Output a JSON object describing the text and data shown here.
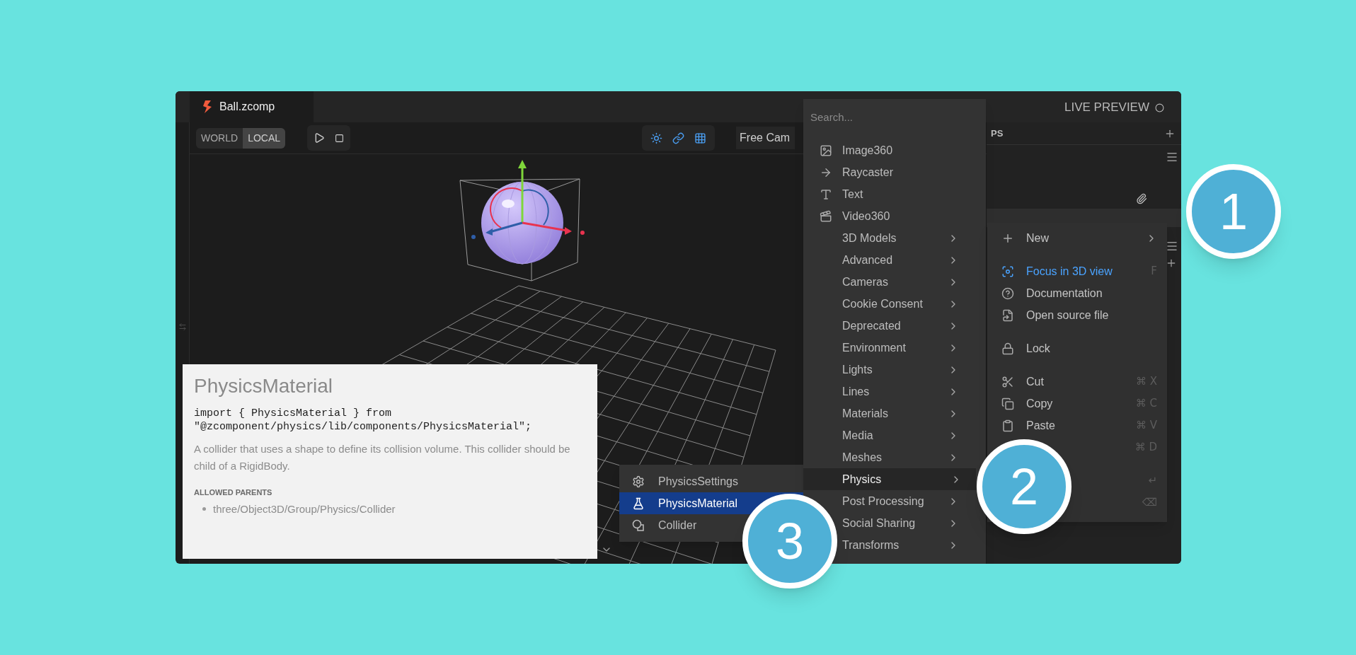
{
  "tab": {
    "title": "Ball.zcomp"
  },
  "live_preview": {
    "label": "LIVE PREVIEW"
  },
  "space_toggle": [
    {
      "label": "WORLD",
      "selected": false
    },
    {
      "label": "LOCAL",
      "selected": true
    }
  ],
  "camera_field": {
    "value": "Free Cam"
  },
  "panel": {
    "header": "PS"
  },
  "add_menu": {
    "search": {
      "placeholder": "Search..."
    },
    "items": [
      {
        "label": "Image360",
        "kind": "component",
        "selected": false
      },
      {
        "label": "Raycaster",
        "kind": "component",
        "selected": false
      },
      {
        "label": "Text",
        "kind": "component",
        "selected": false
      },
      {
        "label": "Video360",
        "kind": "component",
        "selected": false
      },
      {
        "label": "3D Models",
        "kind": "category",
        "selected": false
      },
      {
        "label": "Advanced",
        "kind": "category",
        "selected": false
      },
      {
        "label": "Cameras",
        "kind": "category",
        "selected": false
      },
      {
        "label": "Cookie Consent",
        "kind": "category",
        "selected": false
      },
      {
        "label": "Deprecated",
        "kind": "category",
        "selected": false
      },
      {
        "label": "Environment",
        "kind": "category",
        "selected": false
      },
      {
        "label": "Lights",
        "kind": "category",
        "selected": false
      },
      {
        "label": "Lines",
        "kind": "category",
        "selected": false
      },
      {
        "label": "Materials",
        "kind": "category",
        "selected": false
      },
      {
        "label": "Media",
        "kind": "category",
        "selected": false
      },
      {
        "label": "Meshes",
        "kind": "category",
        "selected": false
      },
      {
        "label": "Physics",
        "kind": "category",
        "selected": true
      },
      {
        "label": "Post Processing",
        "kind": "category",
        "selected": false
      },
      {
        "label": "Social Sharing",
        "kind": "category",
        "selected": false
      },
      {
        "label": "Transforms",
        "kind": "category",
        "selected": false
      }
    ]
  },
  "physics_menu": {
    "items": [
      {
        "label": "PhysicsSettings",
        "selected": false
      },
      {
        "label": "PhysicsMaterial",
        "selected": true
      },
      {
        "label": "Collider",
        "selected": false
      }
    ]
  },
  "context_menu": {
    "groups": [
      {
        "items": [
          {
            "label": "New",
            "kind": "submenu",
            "selected": false
          }
        ]
      },
      {
        "items": [
          {
            "label": "Focus in 3D view",
            "kind": "action",
            "shortcut": "F",
            "selected": true
          },
          {
            "label": "Documentation",
            "kind": "action",
            "selected": false
          },
          {
            "label": "Open source file",
            "kind": "action",
            "selected": false
          }
        ]
      },
      {
        "items": [
          {
            "label": "Lock",
            "kind": "action",
            "selected": false
          }
        ]
      },
      {
        "items": [
          {
            "label": "Cut",
            "kind": "action",
            "shortcut": "⌘ X",
            "selected": false
          },
          {
            "label": "Copy",
            "kind": "action",
            "shortcut": "⌘ C",
            "selected": false
          },
          {
            "label": "Paste",
            "kind": "action",
            "shortcut": "⌘ V",
            "selected": false
          },
          {
            "shortcut": "⌘ D"
          }
        ]
      },
      {
        "items": [
          {
            "shortcut": "↵"
          },
          {
            "shortcut": "⌫"
          }
        ]
      }
    ]
  },
  "doc": {
    "title": "PhysicsMaterial",
    "code": "import { PhysicsMaterial } from\n\"@zcomponent/physics/lib/components/PhysicsMaterial\";",
    "description": "A collider that uses a shape to define its collision volume. This collider should be child of a RigidBody.",
    "section_title": "ALLOWED PARENTS",
    "parents": [
      "three/Object3D/Group/Physics/Collider"
    ]
  },
  "callouts": [
    {
      "number": "1"
    },
    {
      "number": "2"
    },
    {
      "number": "3"
    }
  ]
}
